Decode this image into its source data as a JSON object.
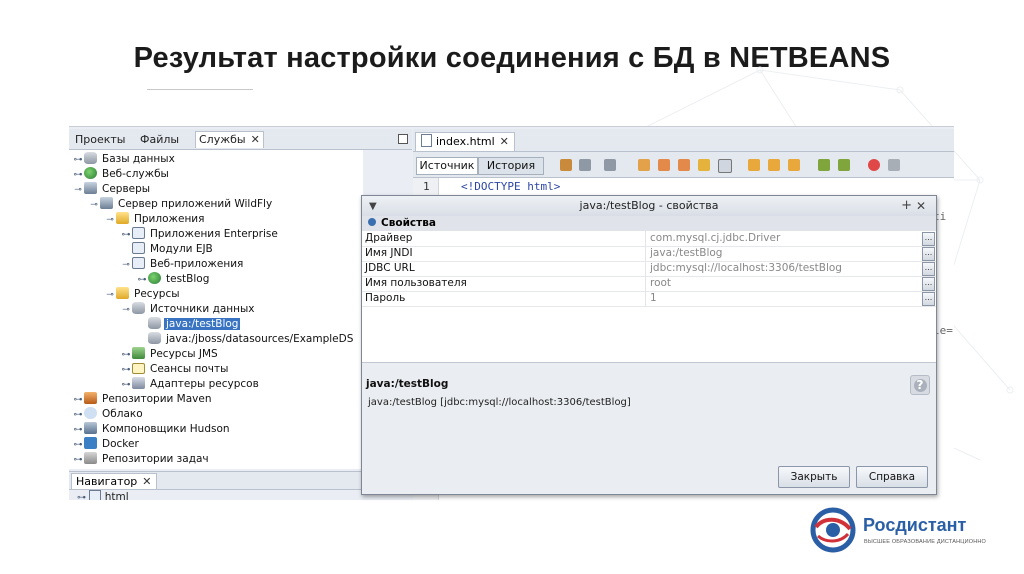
{
  "slide": {
    "title": "Результат настройки соединения с БД в NETBEANS"
  },
  "left_panel": {
    "tabs": [
      {
        "label": "Проекты"
      },
      {
        "label": "Файлы"
      },
      {
        "label": "Службы",
        "active": true
      }
    ],
    "tree": [
      {
        "label": "Базы данных",
        "icon": "database-icon"
      },
      {
        "label": "Веб-службы",
        "icon": "globe-icon"
      },
      {
        "label": "Серверы",
        "icon": "server-icon"
      },
      {
        "label": "Сервер приложений WildFly",
        "icon": "server-icon"
      },
      {
        "label": "Приложения",
        "icon": "folder-icon"
      },
      {
        "label": "Приложения Enterprise",
        "icon": "enterprise-app-icon"
      },
      {
        "label": "Модули EJB",
        "icon": "ejb-module-icon"
      },
      {
        "label": "Веб-приложения",
        "icon": "web-app-icon"
      },
      {
        "label": "testBlog",
        "icon": "web-app-icon"
      },
      {
        "label": "Ресурсы",
        "icon": "resources-icon"
      },
      {
        "label": "Источники данных",
        "icon": "database-icon"
      },
      {
        "label": "java:/testBlog",
        "icon": "database-icon",
        "selected": true
      },
      {
        "label": "java:/jboss/datasources/ExampleDS",
        "icon": "database-icon"
      },
      {
        "label": "Ресурсы JMS",
        "icon": "jms-icon"
      },
      {
        "label": "Сеансы почты",
        "icon": "mail-icon"
      },
      {
        "label": "Адаптеры ресурсов",
        "icon": "adapter-icon"
      },
      {
        "label": "Репозитории Maven",
        "icon": "maven-icon"
      },
      {
        "label": "Облако",
        "icon": "cloud-icon"
      },
      {
        "label": "Компоновщики Hudson",
        "icon": "hudson-icon"
      },
      {
        "label": "Docker",
        "icon": "docker-icon"
      },
      {
        "label": "Репозитории задач",
        "icon": "task-repo-icon"
      }
    ],
    "navigator": {
      "tab": "Навигатор",
      "root": "html"
    }
  },
  "editor": {
    "tab": "index.html",
    "source_button": "Источник",
    "history_button": "История",
    "line_number": "1",
    "code_line": "<!DOCTYPE html>",
    "fragments": [
      "ti",
      "le="
    ]
  },
  "dialog": {
    "title": "java:/testBlog - свойства",
    "section": "Свойства",
    "properties": [
      {
        "name": "Драйвер",
        "value": "com.mysql.cj.jdbc.Driver"
      },
      {
        "name": "Имя JNDI",
        "value": "java:/testBlog"
      },
      {
        "name": "JDBC URL",
        "value": "jdbc:mysql://localhost:3306/testBlog"
      },
      {
        "name": "Имя пользователя",
        "value": "root"
      },
      {
        "name": "Пароль",
        "value": "1"
      }
    ],
    "description_title": "java:/testBlog",
    "description_text": "java:/testBlog [jdbc:mysql://localhost:3306/testBlog]",
    "close_button": "Закрыть",
    "help_button": "Справка"
  },
  "logo": {
    "name": "Росдистант",
    "tagline": "ВЫСШЕЕ ОБРАЗОВАНИЕ ДИСТАНЦИОННО"
  },
  "colors": {
    "selection": "#3874c2",
    "brand": "#2a5fa6",
    "brand_red": "#d1323a"
  }
}
